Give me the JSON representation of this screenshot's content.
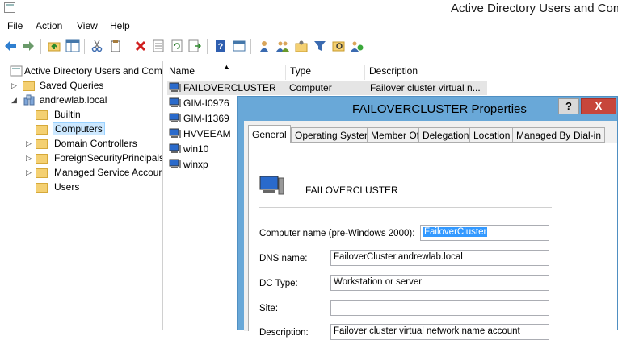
{
  "window": {
    "title": "Active Directory Users and Com"
  },
  "menu": [
    "File",
    "Action",
    "View",
    "Help"
  ],
  "toolbar": {
    "icons": [
      "back-arrow-icon",
      "forward-arrow-icon",
      "up-folder-icon",
      "show-hide-tree-icon",
      "cut-icon",
      "copy-icon",
      "delete-icon",
      "properties-icon",
      "refresh-icon",
      "export-list-icon",
      "help-icon",
      "console-icon",
      "new-user-icon",
      "new-group-icon",
      "new-ou-icon",
      "filter-icon",
      "find-icon",
      "add-to-group-icon"
    ]
  },
  "tree": {
    "root": "Active Directory Users and Com",
    "saved_queries": "Saved Queries",
    "domain": "andrewlab.local",
    "children": [
      "Builtin",
      "Computers",
      "Domain Controllers",
      "ForeignSecurityPrincipals",
      "Managed Service Accour",
      "Users"
    ]
  },
  "list": {
    "headers": [
      "Name",
      "Type",
      "Description"
    ],
    "rows": [
      {
        "name": "FAILOVERCLUSTER",
        "type": "Computer",
        "description": "Failover cluster virtual n..."
      },
      {
        "name": "GIM-I0976",
        "type": "",
        "description": ""
      },
      {
        "name": "GIM-I1369",
        "type": "",
        "description": ""
      },
      {
        "name": "HVVEEAM",
        "type": "",
        "description": ""
      },
      {
        "name": "win10",
        "type": "",
        "description": ""
      },
      {
        "name": "winxp",
        "type": "",
        "description": ""
      }
    ]
  },
  "dialog": {
    "title": "FAILOVERCLUSTER Properties",
    "help": "?",
    "close": "X",
    "tabs": [
      "General",
      "Operating System",
      "Member Of",
      "Delegation",
      "Location",
      "Managed By",
      "Dial-in"
    ],
    "object_name": "FAILOVERCLUSTER",
    "fields": {
      "computer_name_label": "Computer name (pre-Windows 2000):",
      "computer_name_value": "FailoverCluster",
      "dns_label": "DNS name:",
      "dns_value": "FailoverCluster.andrewlab.local",
      "dc_type_label": "DC Type:",
      "dc_type_value": "Workstation or server",
      "site_label": "Site:",
      "site_value": "",
      "description_label": "Description:",
      "description_value": "Failover cluster virtual network name account"
    }
  }
}
